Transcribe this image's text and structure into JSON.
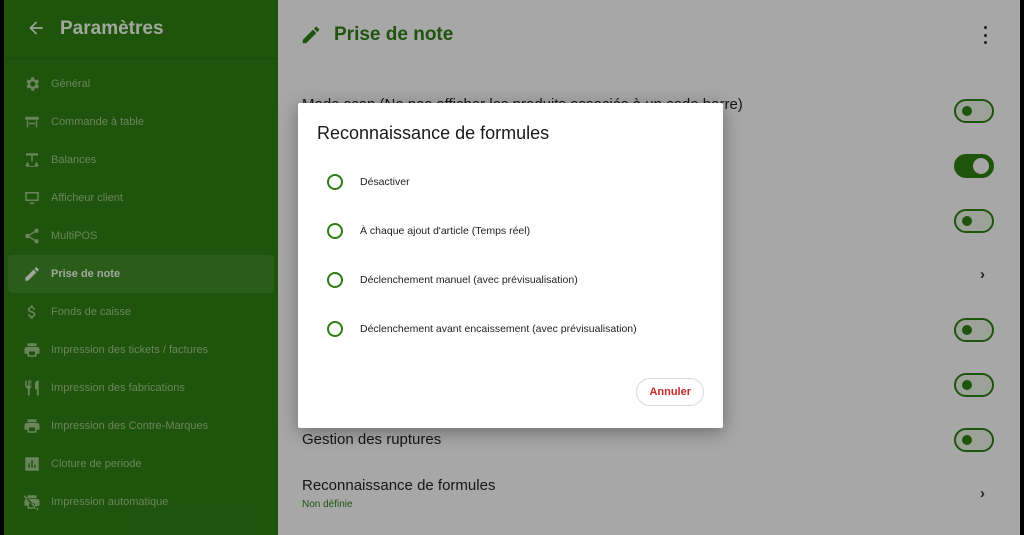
{
  "sidebar": {
    "title": "Paramètres",
    "back_icon": "arrow-left-icon",
    "items": [
      {
        "label": "Général",
        "icon": "gear-icon"
      },
      {
        "label": "Commande à table",
        "icon": "table-icon"
      },
      {
        "label": "Balances",
        "icon": "scale-icon"
      },
      {
        "label": "Afficheur client",
        "icon": "monitor-icon"
      },
      {
        "label": "MultiPOS",
        "icon": "share-icon"
      },
      {
        "label": "Prise de note",
        "icon": "pencil-icon",
        "active": true
      },
      {
        "label": "Fonds de caisse",
        "icon": "dollar-icon"
      },
      {
        "label": "Impression des tickets / factures",
        "icon": "printer-icon"
      },
      {
        "label": "Impression des fabrications",
        "icon": "cutlery-icon"
      },
      {
        "label": "Impression des Contre-Marques",
        "icon": "printer-icon"
      },
      {
        "label": "Cloture de periode",
        "icon": "chart-icon"
      },
      {
        "label": "Impression automatique",
        "icon": "printer-off-icon"
      }
    ]
  },
  "main": {
    "title": "Prise de note",
    "title_icon": "pencil-icon",
    "menu_icon": "more-vertical-icon",
    "settings": {
      "mode_partial": "Mode scan (Ne pas afficher les produits associés à un code barre)",
      "ruptures": "Gestion des ruptures",
      "formules_title": "Reconnaissance de formules",
      "formules_value": "Non définie"
    }
  },
  "dialog": {
    "title": "Reconnaissance de formules",
    "options": [
      "Désactiver",
      "À chaque ajout d'article (Temps réel)",
      "Déclenchement manuel (avec prévisualisation)",
      "Déclenchement avant encaissement (avec prévisualisation)"
    ],
    "cancel": "Annuler"
  },
  "colors": {
    "primary": "#2e7d14",
    "cancel_text": "#c62828"
  }
}
